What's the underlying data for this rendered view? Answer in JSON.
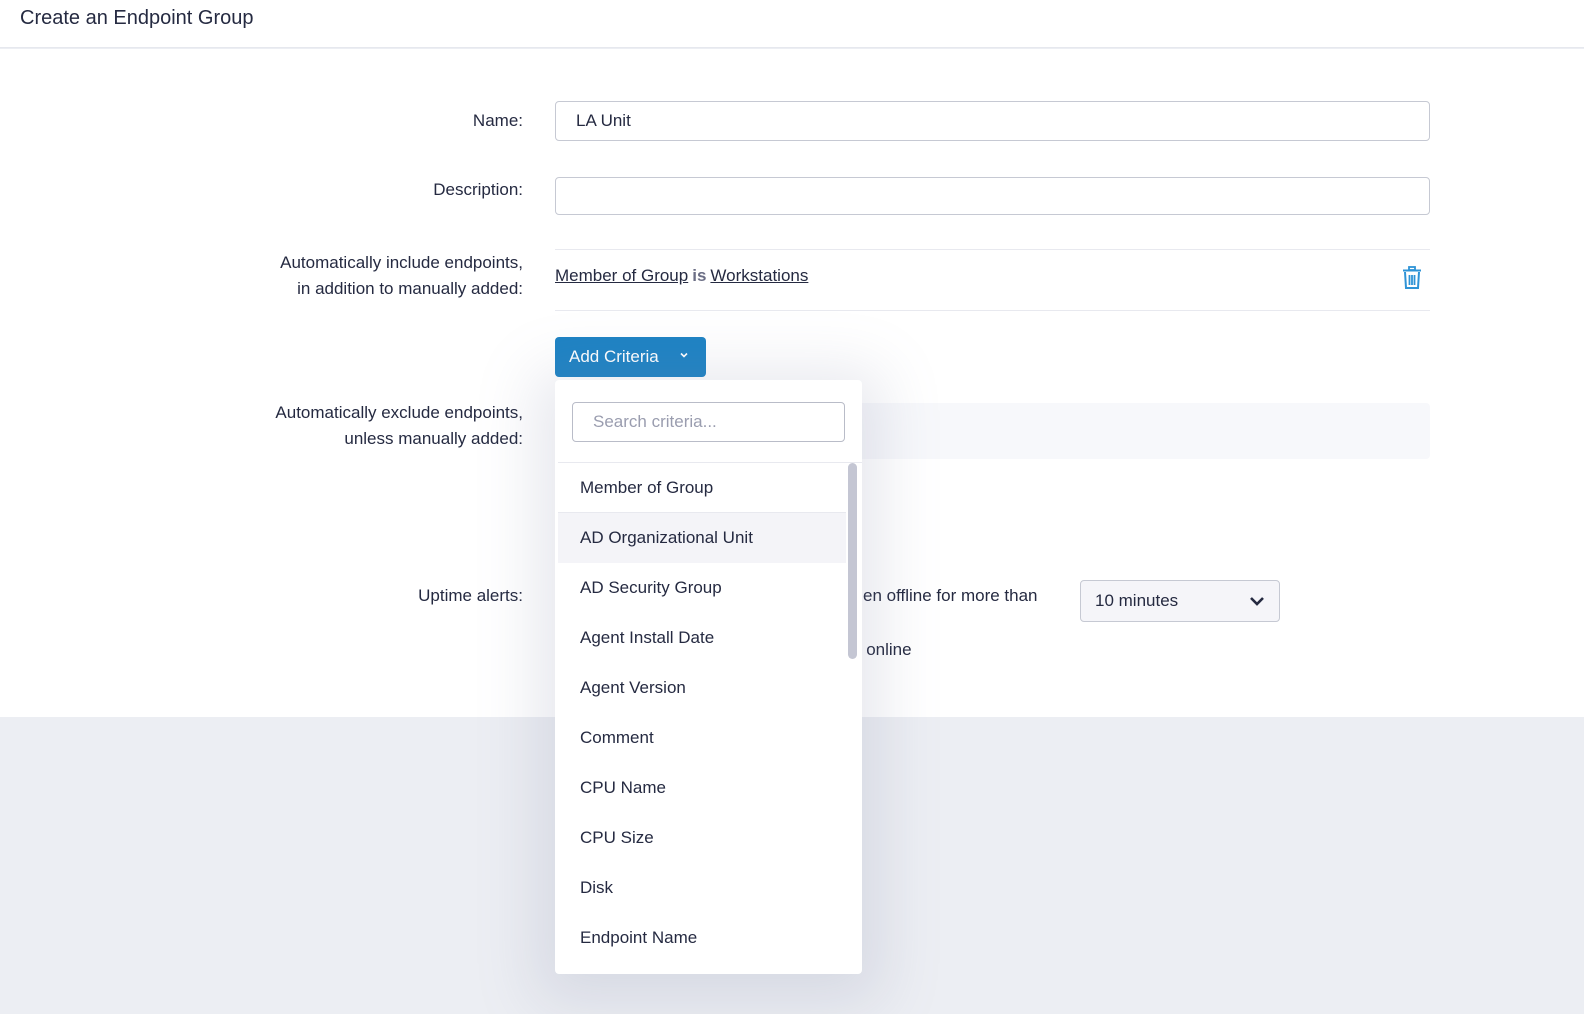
{
  "header": {
    "title": "Create an Endpoint Group"
  },
  "form": {
    "name": {
      "label": "Name:",
      "value": "LA Unit"
    },
    "description": {
      "label": "Description:",
      "value": ""
    },
    "include": {
      "label_line1": "Automatically include endpoints,",
      "label_line2": "in addition to manually added:",
      "criteria": [
        {
          "field": "Member of Group",
          "operator": "is",
          "value": "Workstations"
        }
      ],
      "delete_icon": "trash-icon"
    },
    "add_criteria_button": "Add Criteria",
    "exclude": {
      "label_line1": "Automatically exclude endpoints,",
      "label_line2": "unless manually added:"
    },
    "uptime": {
      "label": "Uptime alerts:",
      "offline_text_partial": "en offline for more than",
      "offline_select_value": "10 minutes",
      "online_text_partial": "k online"
    }
  },
  "criteria_dropdown": {
    "search_placeholder": "Search criteria...",
    "items": [
      "Member of Group",
      "AD Organizational Unit",
      "AD Security Group",
      "Agent Install Date",
      "Agent Version",
      "Comment",
      "CPU Name",
      "CPU Size",
      "Disk",
      "Endpoint Name"
    ],
    "hovered_index": 1
  },
  "colors": {
    "primary": "#1e83c4",
    "text": "#252a41",
    "page_bg": "#eceef3"
  }
}
